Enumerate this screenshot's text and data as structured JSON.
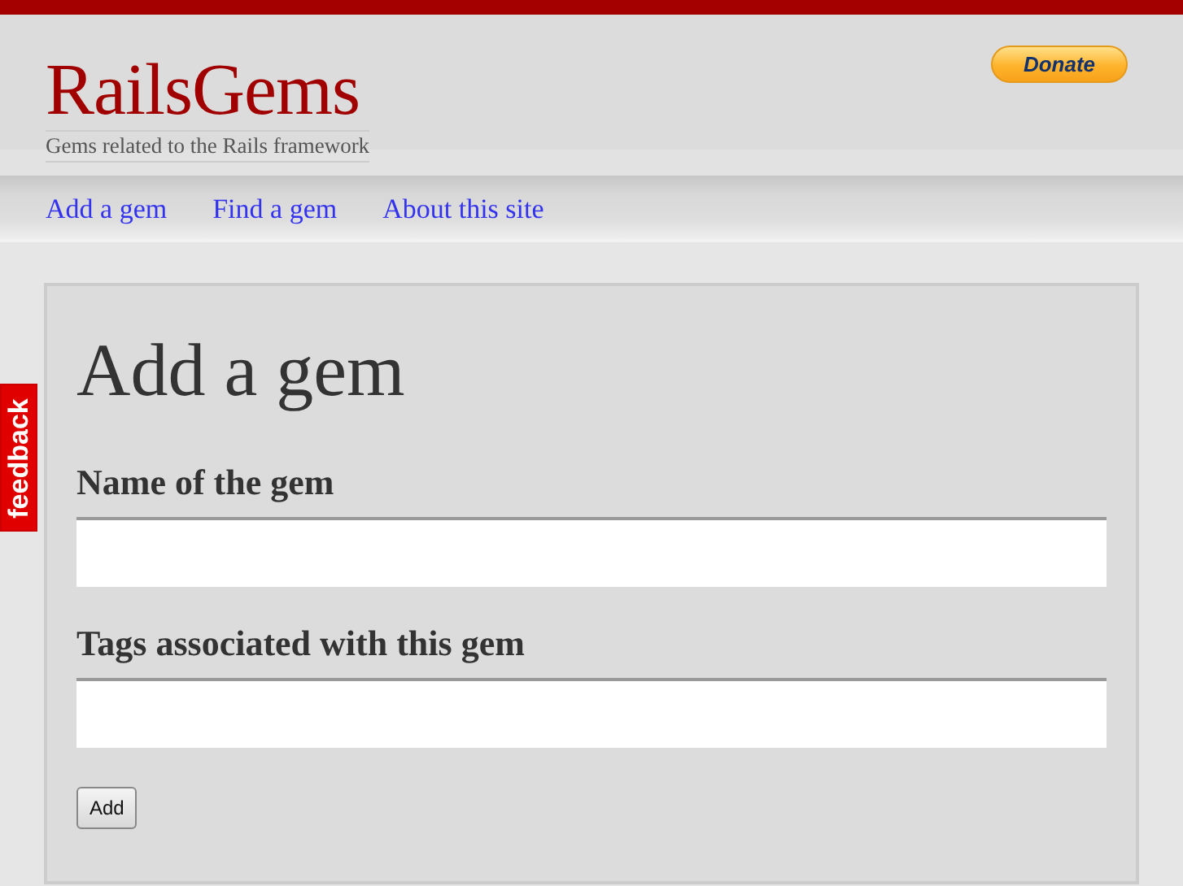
{
  "header": {
    "logo": "RailsGems",
    "tagline": "Gems related to the Rails framework",
    "donate": "Donate"
  },
  "nav": [
    {
      "label": "Add a gem"
    },
    {
      "label": "Find a gem"
    },
    {
      "label": "About this site"
    }
  ],
  "feedback": "feedback",
  "form": {
    "title": "Add a gem",
    "fields": [
      {
        "label": "Name of the gem"
      },
      {
        "label": "Tags associated with this gem"
      }
    ],
    "submit": "Add"
  }
}
